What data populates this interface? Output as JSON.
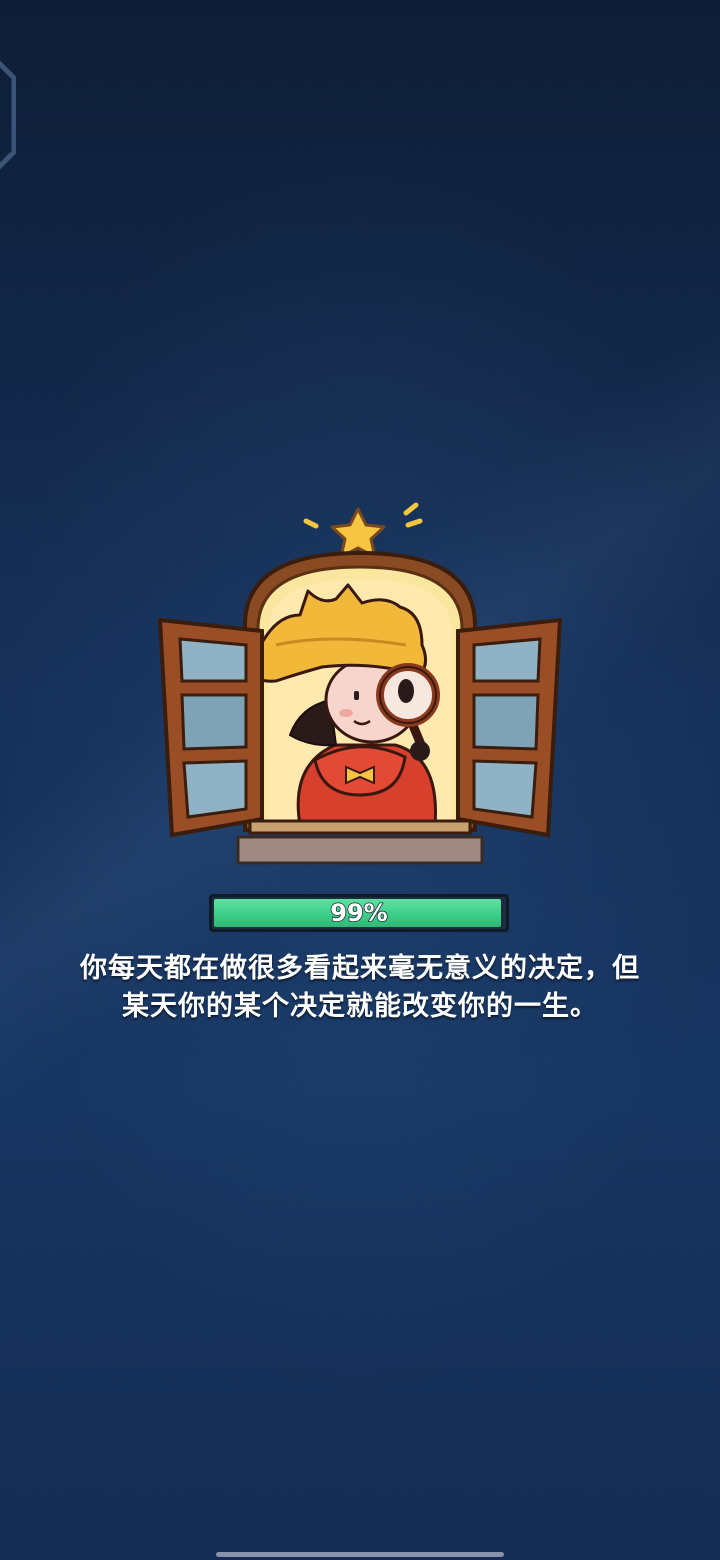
{
  "loading": {
    "progress_label": "99%",
    "progress_fraction": 0.99,
    "tip_line1": "你每天都在做很多看起来毫无意义的决定，但",
    "tip_line2": "某天你的某个决定就能改变你的一生。"
  },
  "colors": {
    "background_top": "#0e1d36",
    "background_bottom": "#173662",
    "progress_fill": "#3ccf88",
    "progress_track": "#1c2d3f",
    "text": "#ffffff"
  },
  "icons": {
    "illustration": "detective-character-at-window",
    "top_ornament": "star-icon"
  }
}
